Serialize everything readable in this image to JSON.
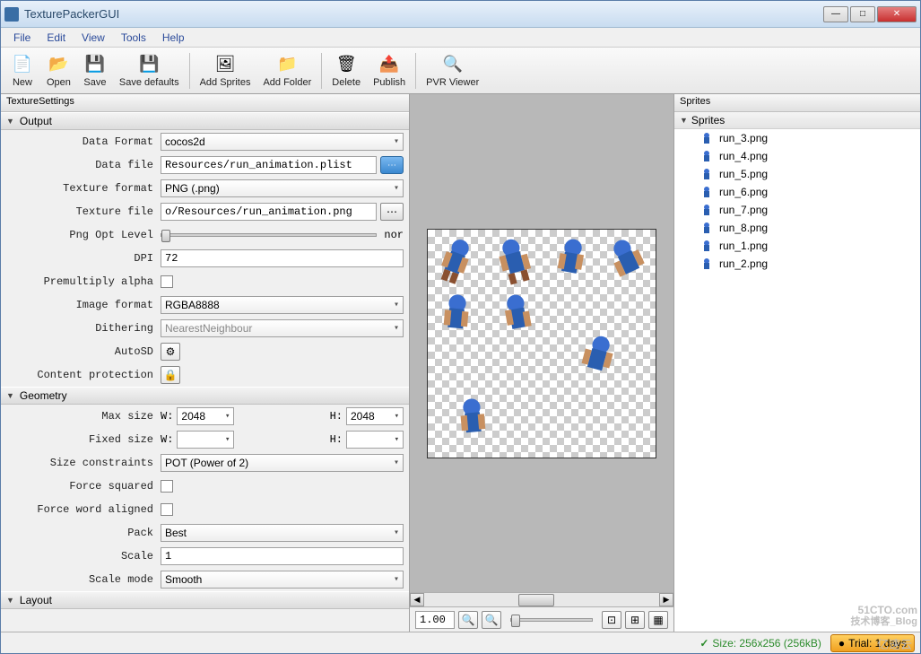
{
  "window": {
    "title": "TexturePackerGUI"
  },
  "menu": {
    "file": "File",
    "edit": "Edit",
    "view": "View",
    "tools": "Tools",
    "help": "Help"
  },
  "toolbar": {
    "new": "New",
    "open": "Open",
    "save": "Save",
    "save_defaults": "Save defaults",
    "add_sprites": "Add Sprites",
    "add_folder": "Add Folder",
    "delete": "Delete",
    "publish": "Publish",
    "pvr_viewer": "PVR Viewer"
  },
  "left": {
    "title": "TextureSettings",
    "output": {
      "header": "Output",
      "data_format_label": "Data Format",
      "data_format": "cocos2d",
      "data_file_label": "Data file",
      "data_file": "Resources/run_animation.plist",
      "texture_format_label": "Texture format",
      "texture_format": "PNG (.png)",
      "texture_file_label": "Texture file",
      "texture_file": "o/Resources/run_animation.png",
      "png_opt_label": "Png Opt Level",
      "png_opt_suffix": "nor",
      "dpi_label": "DPI",
      "dpi": "72",
      "premult_label": "Premultiply alpha",
      "image_format_label": "Image format",
      "image_format": "RGBA8888",
      "dither_label": "Dithering",
      "dither": "NearestNeighbour",
      "autosd_label": "AutoSD",
      "content_prot_label": "Content protection"
    },
    "geometry": {
      "header": "Geometry",
      "max_size_label": "Max size",
      "w_label": "W:",
      "h_label": "H:",
      "max_w": "2048",
      "max_h": "2048",
      "fixed_size_label": "Fixed size",
      "fixed_w": "",
      "fixed_h": "",
      "size_constraints_label": "Size constraints",
      "size_constraints": "POT (Power of 2)",
      "force_squared_label": "Force squared",
      "force_word_label": "Force word aligned",
      "pack_label": "Pack",
      "pack": "Best",
      "scale_label": "Scale",
      "scale": "1",
      "scale_mode_label": "Scale mode",
      "scale_mode": "Smooth"
    },
    "layout": {
      "header": "Layout"
    }
  },
  "center": {
    "zoom": "1.00"
  },
  "right": {
    "title": "Sprites",
    "group": "Sprites",
    "items": [
      "run_3.png",
      "run_4.png",
      "run_5.png",
      "run_6.png",
      "run_7.png",
      "run_8.png",
      "run_1.png",
      "run_2.png"
    ]
  },
  "status": {
    "size": "Size: 256x256 (256kB)",
    "trial": "Trial: 1 days"
  },
  "watermark": {
    "main": "51CTO.com",
    "sub": "技术博客_Blog",
    "cloud": "亿速云"
  }
}
